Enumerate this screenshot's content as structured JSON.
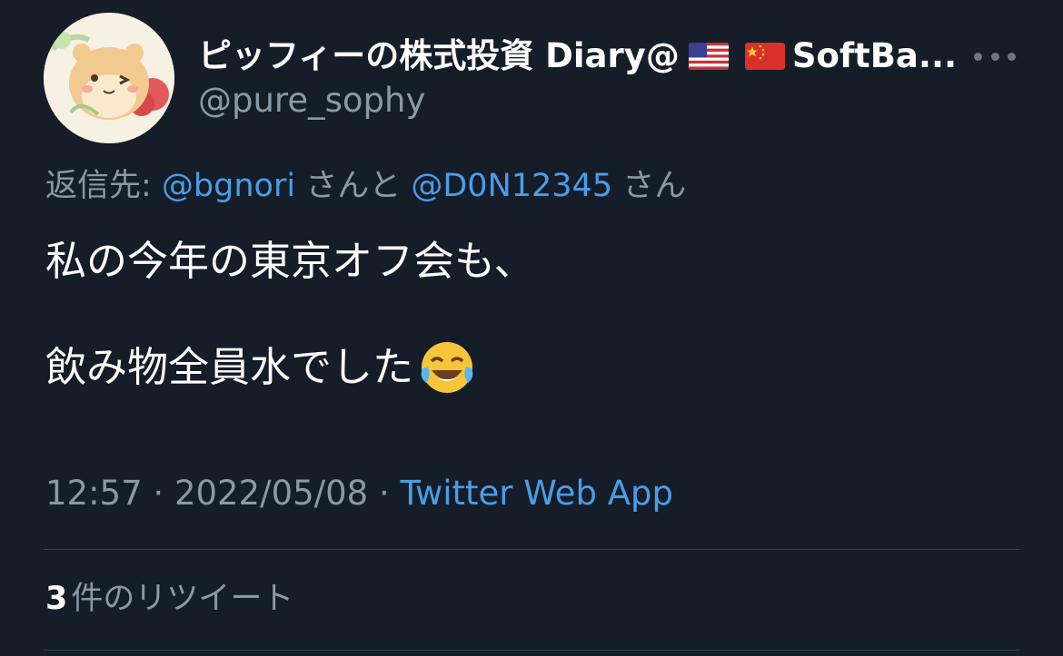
{
  "author": {
    "display_name_prefix": "ピッフィーの株式投資 Diary@",
    "flags": [
      "us-flag",
      "china-flag"
    ],
    "display_name_suffix": "SoftBa...",
    "handle": "@pure_sophy",
    "avatar": "hamster-avatar"
  },
  "reply": {
    "prefix": "返信先: ",
    "user1": "@bgnori",
    "joiner": " さんと ",
    "user2": "@D0N12345",
    "suffix": " さん"
  },
  "tweet": {
    "line1": "私の今年の東京オフ会も、",
    "line2": "飲み物全員水でした",
    "emoji": "face-with-tears-of-joy"
  },
  "meta": {
    "time": "12:57",
    "separator": " · ",
    "date": "2022/05/08",
    "source": "Twitter Web App"
  },
  "stats": {
    "retweet_count": "3",
    "retweet_label": "件のリツイート"
  },
  "colors": {
    "background": "#151d29",
    "link": "#4a9de8",
    "secondary_text": "#8b98a5",
    "divider": "#38444d"
  }
}
